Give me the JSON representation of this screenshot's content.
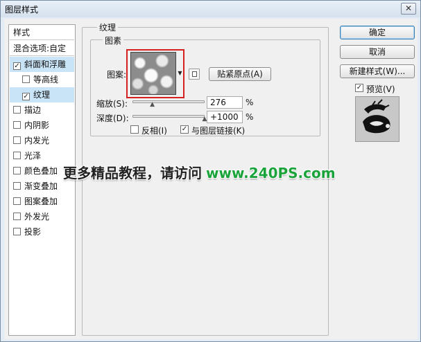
{
  "window": {
    "title": "图层样式",
    "close_glyph": "✕"
  },
  "styles_list": {
    "header": "样式",
    "blending": "混合选项:自定",
    "items": [
      {
        "label": "斜面和浮雕",
        "checked": true
      },
      {
        "label": "等高线",
        "checked": false
      },
      {
        "label": "纹理",
        "checked": true
      },
      {
        "label": "描边",
        "checked": false
      },
      {
        "label": "内阴影",
        "checked": false
      },
      {
        "label": "内发光",
        "checked": false
      },
      {
        "label": "光泽",
        "checked": false
      },
      {
        "label": "颜色叠加",
        "checked": false
      },
      {
        "label": "渐变叠加",
        "checked": false
      },
      {
        "label": "图案叠加",
        "checked": false
      },
      {
        "label": "外发光",
        "checked": false
      },
      {
        "label": "投影",
        "checked": false
      }
    ]
  },
  "texture": {
    "group_title": "纹理",
    "pattern_group_title": "图素",
    "pattern_label": "图案:",
    "snap_origin_label": "贴紧原点(A)",
    "scale_label": "缩放(S):",
    "scale_value": "276",
    "scale_unit": "%",
    "scale_fraction": 0.276,
    "depth_label": "深度(D):",
    "depth_value": "+1000",
    "depth_unit": "%",
    "depth_fraction": 1.0,
    "invert_label": "反相(I)",
    "invert_checked": false,
    "link_label": "与图层链接(K)",
    "link_checked": true
  },
  "buttons": {
    "ok": "确定",
    "cancel": "取消",
    "new_style": "新建样式(W)...",
    "preview_label": "预览(V)",
    "preview_checked": true
  },
  "watermark": {
    "text": "更多精品教程，请访问",
    "url": "www.240PS.com"
  },
  "colors": {
    "accent_selected": "#c9e3f7",
    "pattern_highlight": "#d42020",
    "watermark_url": "#1aa33a"
  },
  "icons": {
    "check": "✓",
    "dropdown": "▼",
    "slider_thumb": "▲"
  }
}
